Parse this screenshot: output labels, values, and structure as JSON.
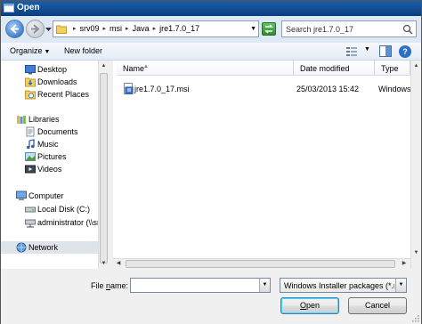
{
  "window": {
    "title": "Open"
  },
  "address": {
    "crumbs": [
      "srv09",
      "msi",
      "Java",
      "jre1.7.0_17"
    ],
    "separator": "▸"
  },
  "search": {
    "placeholder": "Search jre1.7.0_17"
  },
  "toolbar": {
    "organize_label": "Organize",
    "new_folder_label": "New folder",
    "help_label": "?"
  },
  "nav": {
    "items": [
      {
        "label": "Desktop",
        "icon": "desktop-icon"
      },
      {
        "label": "Downloads",
        "icon": "downloads-icon"
      },
      {
        "label": "Recent Places",
        "icon": "recent-places-icon"
      },
      {
        "label": "Libraries",
        "icon": "libraries-icon"
      },
      {
        "label": "Documents",
        "icon": "documents-icon"
      },
      {
        "label": "Music",
        "icon": "music-icon"
      },
      {
        "label": "Pictures",
        "icon": "pictures-icon"
      },
      {
        "label": "Videos",
        "icon": "videos-icon"
      },
      {
        "label": "Computer",
        "icon": "computer-icon"
      },
      {
        "label": "Local Disk (C:)",
        "icon": "local-disk-icon"
      },
      {
        "label": "administrator (\\\\srv",
        "icon": "network-drive-icon"
      },
      {
        "label": "Network",
        "icon": "network-icon"
      }
    ],
    "selected": "Network"
  },
  "columns": {
    "name": "Name",
    "date": "Date modified",
    "type": "Type"
  },
  "files": [
    {
      "name": "jre1.7.0_17.msi",
      "date": "25/03/2013 15:42",
      "type": "Windows Ins"
    }
  ],
  "bottom": {
    "file_name_label_pre": "File ",
    "file_name_label_u": "n",
    "file_name_label_post": "ame:",
    "file_name_value": "",
    "filter_value": "Windows Installer packages (*.r",
    "open_label_u": "O",
    "open_label_rest": "pen",
    "cancel_label": "Cancel"
  },
  "colors": {
    "title_bar": "#0a3e7d",
    "address_bg": "#dfe9f5",
    "selection": "#dfe4ea"
  }
}
